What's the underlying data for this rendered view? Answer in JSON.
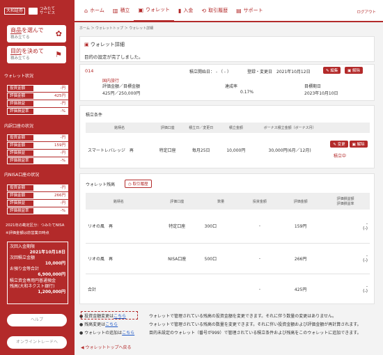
{
  "logo": {
    "left": "大和証券",
    "right1": "つみたて",
    "right2": "サービス"
  },
  "side": {
    "buy1": {
      "t1": "商品",
      "t2": "を選んで",
      "s": "積み立てる"
    },
    "buy2": {
      "t1": "目的",
      "t2": "を決めて",
      "s": "積み立てる"
    },
    "sec1": "ウォレット状況",
    "sec2": "内訳口座の状況",
    "sec3": "内NISA口座の状況",
    "k1": "投資金額",
    "k2": "評価金額",
    "k3": "評価損益",
    "k4": "評価損益率",
    "w": [
      "-円",
      "425円",
      "-円",
      "-%"
    ],
    "i": [
      "-円",
      "159円",
      "-円",
      "-%"
    ],
    "n": [
      "-円",
      "266円",
      "-円",
      "-%"
    ],
    "note1": "2021年の勘定区分：つみたてNISA",
    "note2": "※評価金額は前営業日時点",
    "s1": "次回入金期限",
    "s1v": "2021年10月18日",
    "s2": "次回積立金額",
    "s2v": "10,000円",
    "s3": "お預り金等合計",
    "s3v": "6,900,000円",
    "s4": "積立資金専用円普通預金",
    "s5": "残高(大和ネクスト銀行)",
    "s5v": "1,200,000円",
    "help": "ヘルプ",
    "online": "オンライントレードへ"
  },
  "nav": {
    "home": "ホーム",
    "tsumi": "積立",
    "wallet": "ウォレット",
    "nyukin": "入金",
    "rireki": "取引履歴",
    "support": "サポート",
    "logout": "ログアウト"
  },
  "crumb": "ホーム ＞ ウォレットトップ ＞ ウォレット詳細",
  "detail": {
    "title": "ウォレット詳細",
    "msg": "目的の設定が完了しました。"
  },
  "wallet": {
    "id": "014",
    "start_label": "積立開始日：",
    "start_val": "-  （ - ）",
    "reg_label": "登録・変更日",
    "reg_val": "2021年10月12日",
    "edit": "編集",
    "del": "解除",
    "goal": "国内旅行",
    "eval_label": "評価金額／目標金額",
    "eval_val": "425円／250,000円",
    "rate_label": "達成率",
    "rate_val": "0.17%",
    "date_label": "目標期日",
    "date_val": "2023年10月10日"
  },
  "cond": {
    "title": "積立条件",
    "headers": [
      "銘柄名",
      "評価口座",
      "積立日／変更日",
      "積立金額",
      "ボーナス積立金額（ボーナス月）"
    ],
    "row": [
      "スマートレバレッジ　再",
      "特定口座",
      "毎月25日",
      "10,000円",
      "30,000円(6月／12月)"
    ],
    "change": "変更",
    "del": "解除",
    "status": "積立中"
  },
  "balance": {
    "title": "ウォレット残高",
    "history": "取引履歴",
    "headers": [
      "銘柄名",
      "評価口座",
      "数量",
      "投資金額",
      "評価金額",
      "評価損益額",
      "評価損益率"
    ],
    "rows": [
      [
        "リオの風　再",
        "特定口座",
        "300口",
        "-",
        "159円",
        "-",
        "(-)"
      ],
      [
        "リオの風　再",
        "NISA口座",
        "500口",
        "-",
        "266円",
        "-",
        "(-)"
      ],
      [
        "合計",
        "",
        "",
        "-",
        "425円",
        "-",
        "(-)"
      ]
    ]
  },
  "links": [
    {
      "pre": "投資金額変更は",
      "link": "こちら",
      "desc": "ウォレットで管理されている残高の投資金額を変更できます。それに伴う数量の変更はありません。"
    },
    {
      "pre": "残高変更は",
      "link": "こちら",
      "desc": "ウォレットで管理されている残高の数量を変更できます。それに伴い投資金額および評価金額が再計算されます。"
    },
    {
      "pre": "ウォレットの追加は",
      "link": "こちら",
      "desc": "目的未設定のウォレット（番号が999）で管理されている積立条件および残高をこのウォレットに追加できます。"
    }
  ],
  "back": "ウォレットトップへ戻る"
}
